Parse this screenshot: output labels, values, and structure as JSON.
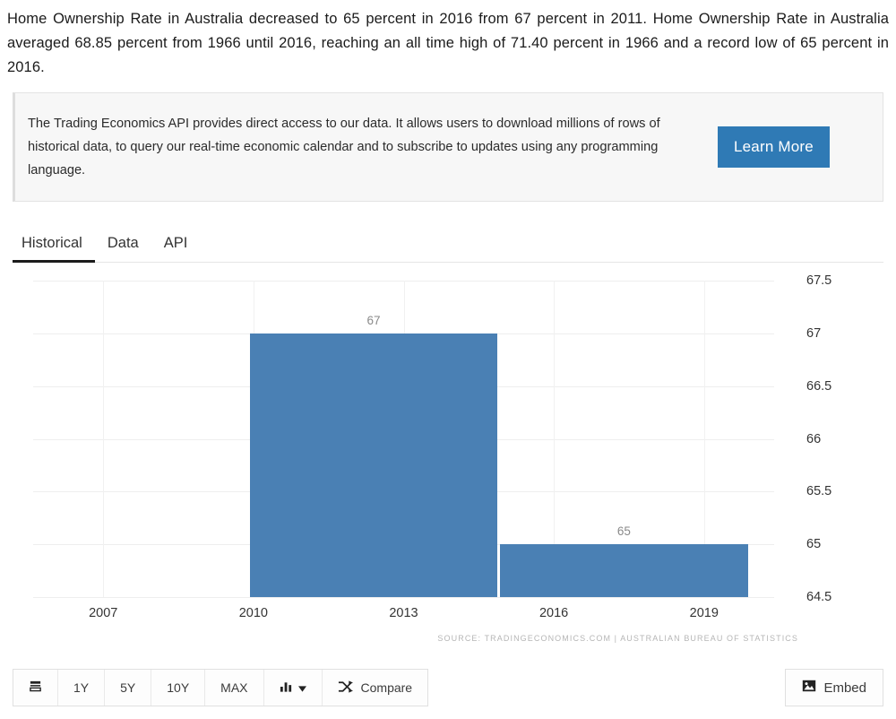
{
  "intro": {
    "text": "Home Ownership Rate in Australia decreased to 65 percent in 2016 from 67 percent in 2011. Home Ownership Rate in Australia averaged 68.85 percent from 1966 until 2016, reaching an all time high of 71.40 percent in 1966 and a record low of 65 percent in 2016."
  },
  "api_banner": {
    "text": "The Trading Economics API provides direct access to our data. It allows users to download millions of rows of historical data, to query our real-time economic calendar and to subscribe to updates using any programming language.",
    "button_label": "Learn More",
    "button_color": "#2f7ab5"
  },
  "tabs": [
    {
      "label": "Historical",
      "active": true
    },
    {
      "label": "Data",
      "active": false
    },
    {
      "label": "API",
      "active": false
    }
  ],
  "chart_data": {
    "type": "bar",
    "title": "",
    "xlabel": "",
    "ylabel": "",
    "categories": [
      "2011",
      "2016"
    ],
    "values": [
      67,
      65
    ],
    "bar_labels": [
      "67",
      "65"
    ],
    "bar_color": "#4a80b4",
    "ylim": [
      64.5,
      67.5
    ],
    "yticks": [
      "67.5",
      "67",
      "66.5",
      "66",
      "65.5",
      "65",
      "64.5"
    ],
    "ytick_values": [
      67.5,
      67,
      66.5,
      66,
      65.5,
      65,
      64.5
    ],
    "xticks": [
      "2007",
      "2010",
      "2013",
      "2016",
      "2019"
    ],
    "xtick_values": [
      2007,
      2010,
      2013,
      2016,
      2019
    ],
    "xlim": [
      2005.6,
      2020.4
    ],
    "grid": true,
    "legend": "none",
    "source_note": "SOURCE: TRADINGECONOMICS.COM | AUSTRALIAN BUREAU OF STATISTICS"
  },
  "toolbar": {
    "ranges": [
      "1Y",
      "5Y",
      "10Y",
      "MAX"
    ],
    "compare_label": "Compare",
    "embed_label": "Embed"
  }
}
